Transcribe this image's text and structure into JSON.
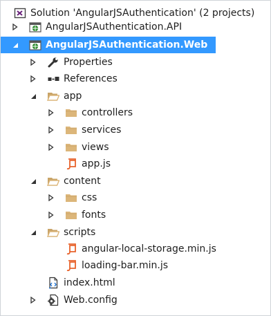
{
  "tree": [
    {
      "label": "Solution 'AngularJSAuthentication' (2 projects)",
      "icon": "solution-icon",
      "expander": "none"
    },
    {
      "label": "AngularJSAuthentication.API",
      "icon": "web-project-icon",
      "expander": "collapsed"
    },
    {
      "label": "AngularJSAuthentication.Web",
      "icon": "web-project-icon",
      "expander": "expanded",
      "selected": true
    },
    {
      "label": "Properties",
      "icon": "wrench-icon",
      "expander": "collapsed"
    },
    {
      "label": "References",
      "icon": "references-icon",
      "expander": "collapsed"
    },
    {
      "label": "app",
      "icon": "folder-open-icon",
      "expander": "expanded"
    },
    {
      "label": "controllers",
      "icon": "folder-icon",
      "expander": "collapsed"
    },
    {
      "label": "services",
      "icon": "folder-icon",
      "expander": "collapsed"
    },
    {
      "label": "views",
      "icon": "folder-icon",
      "expander": "collapsed"
    },
    {
      "label": "app.js",
      "icon": "js-file-icon",
      "expander": "none"
    },
    {
      "label": "content",
      "icon": "folder-open-icon",
      "expander": "expanded"
    },
    {
      "label": "css",
      "icon": "folder-icon",
      "expander": "collapsed"
    },
    {
      "label": "fonts",
      "icon": "folder-icon",
      "expander": "collapsed"
    },
    {
      "label": "scripts",
      "icon": "folder-open-icon",
      "expander": "expanded"
    },
    {
      "label": "angular-local-storage.min.js",
      "icon": "js-file-icon",
      "expander": "none"
    },
    {
      "label": "loading-bar.min.js",
      "icon": "js-file-icon",
      "expander": "none"
    },
    {
      "label": "index.html",
      "icon": "html-file-icon",
      "expander": "none"
    },
    {
      "label": "Web.config",
      "icon": "config-file-icon",
      "expander": "collapsed"
    }
  ],
  "colors": {
    "selection": "#3399ff",
    "folder": "#dcb67a",
    "js_file": "#e8622b",
    "globe": "#2e8b2e"
  }
}
